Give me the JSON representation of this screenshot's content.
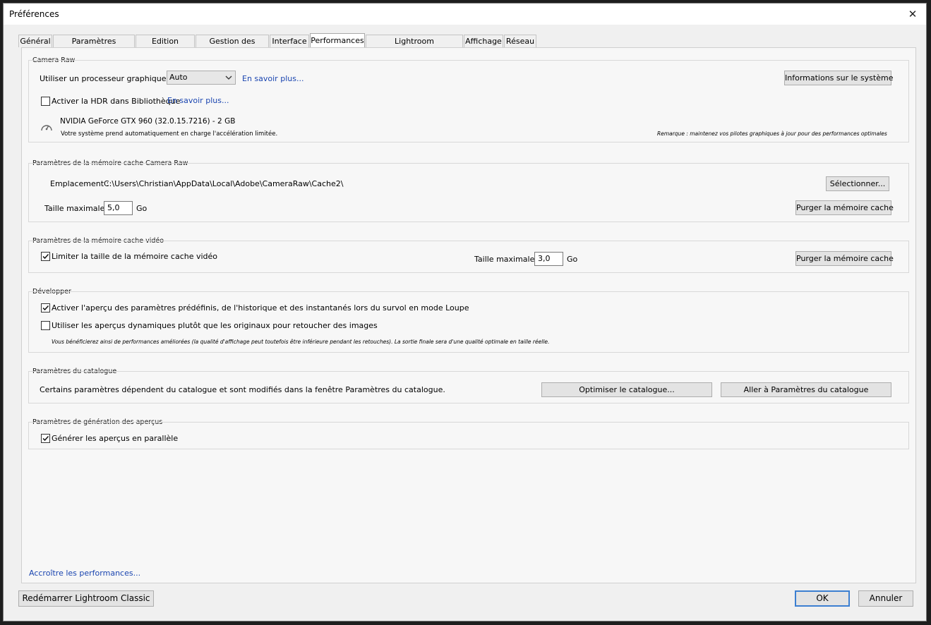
{
  "window": {
    "title": "Préférences"
  },
  "tabs": [
    {
      "label": "Général"
    },
    {
      "label": "Paramètres prédéfinis"
    },
    {
      "label": "Edition externe"
    },
    {
      "label": "Gestion des fichiers"
    },
    {
      "label": "Interface"
    },
    {
      "label": "Performances"
    },
    {
      "label": "Lightroom Synchronisation"
    },
    {
      "label": "Affichage"
    },
    {
      "label": "Réseau"
    }
  ],
  "camera_raw": {
    "title": "Camera Raw",
    "gpu_label": "Utiliser un processeur graphique :",
    "gpu_value": "Auto",
    "gpu_learn_more": "En savoir plus...",
    "system_info_button": "Informations sur le système",
    "hdr_label": "Activer la HDR dans Bibliothèque",
    "hdr_checked": false,
    "hdr_learn_more": "En savoir plus...",
    "gpu_name": "NVIDIA GeForce GTX 960 (32.0.15.7216) - 2 GB",
    "gpu_status": "Votre système prend automatiquement en charge l'accélération limitée.",
    "note": "Remarque : maintenez vos pilotes graphiques à jour pour des performances optimales"
  },
  "cache_raw": {
    "title": "Paramètres de la mémoire cache Camera Raw",
    "location_label": "Emplacement :",
    "location_value": "C:\\Users\\Christian\\AppData\\Local\\Adobe\\CameraRaw\\Cache2\\",
    "select_button": "Sélectionner...",
    "max_size_label": "Taille maximale :",
    "max_size_value": "5,0",
    "unit": "Go",
    "purge_button": "Purger la mémoire cache"
  },
  "cache_video": {
    "title": "Paramètres de la mémoire cache vidéo",
    "limit_label": "Limiter la taille de la mémoire cache vidéo",
    "limit_checked": true,
    "max_size_label": "Taille maximale :",
    "max_size_value": "3,0",
    "unit": "Go",
    "purge_button": "Purger la mémoire cache"
  },
  "develop": {
    "title": "Développer",
    "preview_label": "Activer l'aperçu des paramètres prédéfinis, de l'historique et des instantanés lors du survol en mode Loupe",
    "preview_checked": true,
    "smart_previews_label": "Utiliser les aperçus dynamiques plutôt que les originaux pour retoucher des images",
    "smart_previews_checked": false,
    "smart_previews_note": "Vous bénéficierez ainsi de performances améliorées (la qualité d'affichage peut toutefois être inférieure pendant les retouches). La sortie finale sera d'une qualité optimale en taille réelle."
  },
  "catalog": {
    "title": "Paramètres du catalogue",
    "description": "Certains paramètres dépendent du catalogue et sont modifiés dans la fenêtre Paramètres du catalogue.",
    "optimize_button": "Optimiser le catalogue...",
    "goto_button": "Aller à Paramètres du catalogue"
  },
  "previews": {
    "title": "Paramètres de génération des aperçus",
    "parallel_label": "Générer les aperçus en parallèle",
    "parallel_checked": true
  },
  "footer": {
    "more_performance_link": "Accroître les performances...",
    "restart_button": "Redémarrer Lightroom Classic",
    "ok_button": "OK",
    "cancel_button": "Annuler"
  },
  "colors": {
    "link": "#1a45b0",
    "default_button_border": "#3c7fd1"
  }
}
